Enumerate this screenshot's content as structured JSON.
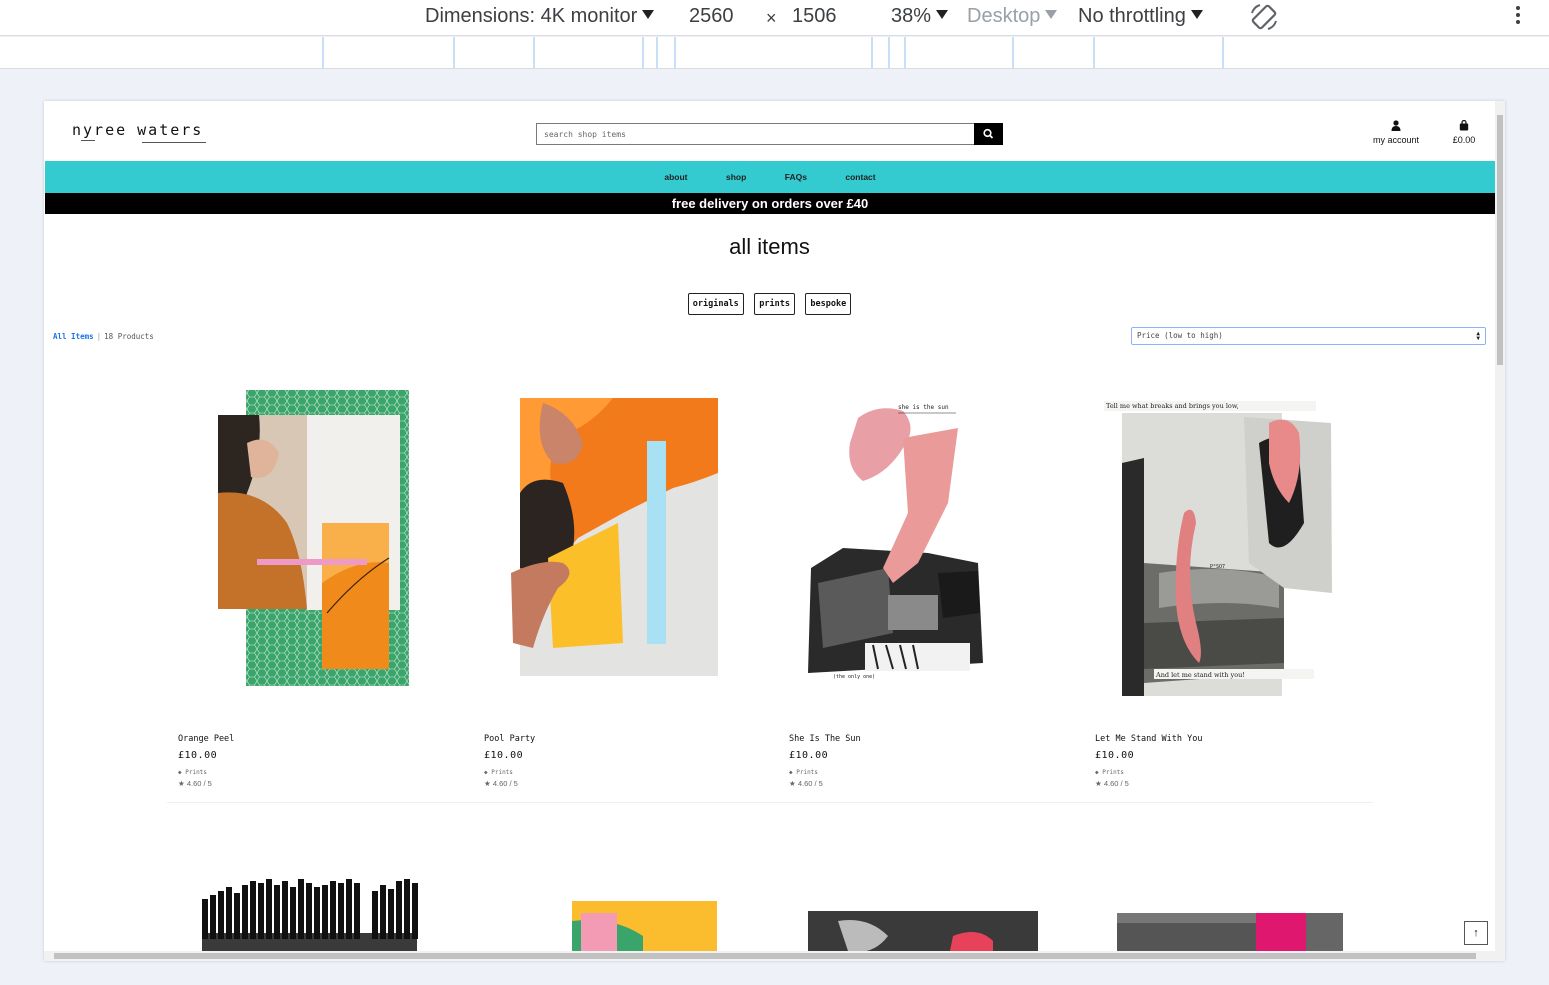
{
  "devtools": {
    "dimensions_label": "Dimensions: 4K monitor",
    "width": "2560",
    "times": "×",
    "height": "1506",
    "zoom": "38%",
    "device_type": "Desktop",
    "throttling": "No throttling"
  },
  "site": {
    "logo_word1": "nyree",
    "logo_word2": "waters",
    "search_placeholder": "search shop items",
    "account_label": "my account",
    "cart_total": "£0.00",
    "nav": [
      "about",
      "shop",
      "FAQs",
      "contact"
    ],
    "banner": "free delivery on orders over £40",
    "page_title": "all items",
    "categories": [
      "originals",
      "prints",
      "bespoke"
    ],
    "breadcrumb_link": "All Items",
    "breadcrumb_sep": "|",
    "product_count": "18 Products",
    "sort_value": "Price (low to high)",
    "back_to_top": "↑"
  },
  "products": [
    {
      "name": "Orange Peel",
      "price": "£10.00",
      "category": "Prints",
      "rating": "4.60 / 5"
    },
    {
      "name": "Pool Party",
      "price": "£10.00",
      "category": "Prints",
      "rating": "4.60 / 5"
    },
    {
      "name": "She Is The Sun",
      "price": "£10.00",
      "category": "Prints",
      "rating": "4.60 / 5"
    },
    {
      "name": "Let Me Stand With You",
      "price": "£10.00",
      "category": "Prints",
      "rating": "4.60 / 5"
    }
  ],
  "artwork_text": {
    "sun_top": "she is the   sun",
    "sun_bottom": "(the only one)",
    "stand_top": "Tell   me what breaks and    brings   you  low,",
    "stand_mid": "P°SO7",
    "stand_bottom": "And  let  me  stand  with    you!"
  },
  "colors": {
    "nav_bg": "#33cbd0",
    "banner_bg": "#000000",
    "link": "#1a73e8"
  }
}
